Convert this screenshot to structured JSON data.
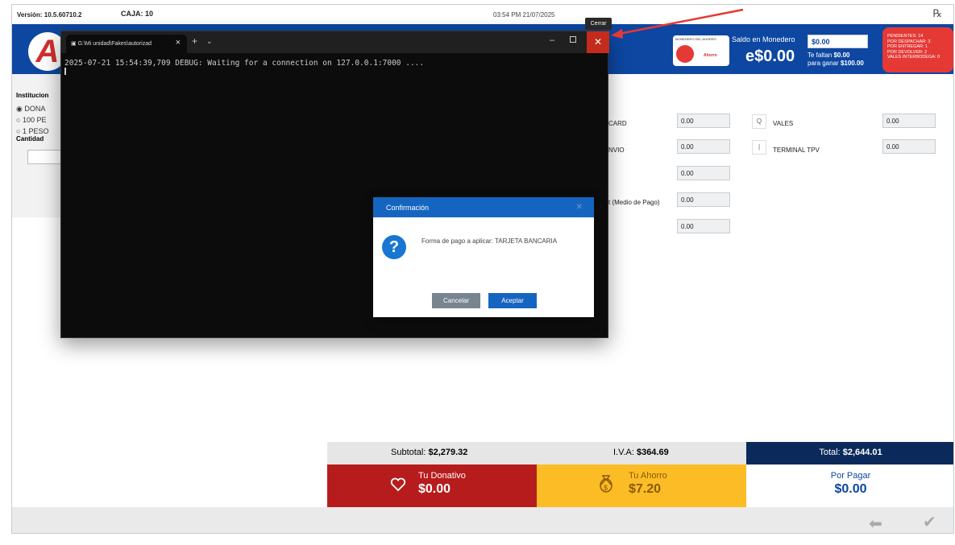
{
  "topbar": {
    "version": "Versión: 10.5.60710.2",
    "caja": "CAJA: 10",
    "datetime": "03:54 PM 21/07/2025",
    "rx": "℞"
  },
  "logo": {
    "letter": "A"
  },
  "monedero": {
    "card_top": "MONEDERO DEL AHORRO",
    "card_brand": "Ahorro",
    "title": "Saldo en Monedero",
    "balance": "e$0.00",
    "input_value": "$0.00",
    "faltan_label": "Te faltan",
    "faltan_amount": "$0.00",
    "ganar_label": "para ganar",
    "ganar_amount": "$100.00"
  },
  "pending": {
    "lines": [
      "PENDIENTES: 14",
      "POR DESPACHAR: 3",
      "POR ENTREGAR: 1",
      "POR DEVOLVER: 2",
      "VALES INTERBODEGA: 0"
    ]
  },
  "left": {
    "instituciones_label": "Institucion",
    "radio1": "DONA",
    "radio2": "100 PE",
    "radio3": "1 PESO",
    "cantidad_label": "Cantidad"
  },
  "payments": {
    "card_label": "CARD",
    "card_value": "0.00",
    "envio_label": "NVIO",
    "envio_value": "0.00",
    "row3_value": "0.00",
    "medio_label": "t (Medio de Pago)",
    "medio_value": "0.00",
    "row5_value": "0.00",
    "vales_label": "VALES",
    "vales_value": "0.00",
    "vales_icon": "Q",
    "tpv_label": "TERMINAL TPV",
    "tpv_value": "0.00",
    "tpv_icon": "|"
  },
  "totals": {
    "subtotal_label": "Subtotal:",
    "subtotal": "$2,279.32",
    "iva_label": "I.V.A:",
    "iva": "$364.69",
    "total_label": "Total:",
    "total": "$2,644.01"
  },
  "tiles": {
    "donativo_label": "Tu Donativo",
    "donativo": "$0.00",
    "ahorro_label": "Tu Ahorro",
    "ahorro": "$7.20",
    "porpagar_label": "Por Pagar",
    "porpagar": "$0.00"
  },
  "terminal": {
    "tab_title": "G:\\Mi unidad\\Fakes\\autorizad",
    "log": "2025-07-21 15:54:39,709 DEBUG: Waiting for a connection on 127.0.0.1:7000 ...."
  },
  "tooltip": {
    "text": "Cerrar"
  },
  "dialog": {
    "title": "Confirmación",
    "message": "Forma de pago a aplicar: TARJETA BANCARIA",
    "cancel": "Cancelar",
    "ok": "Aceptar"
  },
  "colors": {
    "brand_blue": "#0d47a1",
    "red": "#b71c1c",
    "yellow": "#fbbc26",
    "close_red": "#c42b1c"
  }
}
